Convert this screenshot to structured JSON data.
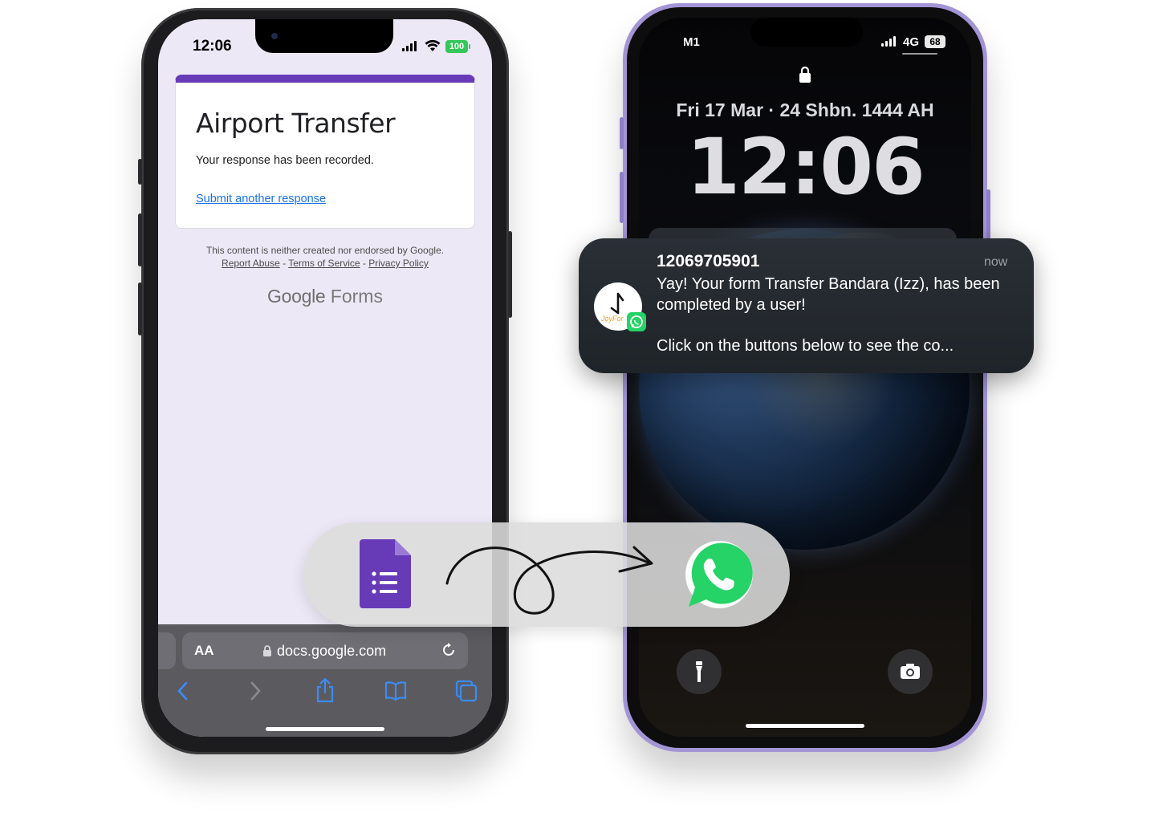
{
  "left_phone": {
    "status": {
      "time": "12:06",
      "battery": "100"
    },
    "form": {
      "title": "Airport Transfer",
      "message": "Your response has been recorded.",
      "link": "Submit another response"
    },
    "footer": {
      "disclaimer": "This content is neither created nor endorsed by Google.",
      "links": [
        "Report Abuse",
        "Terms of Service",
        "Privacy Policy"
      ],
      "separator": " - ",
      "logo_google": "Google",
      "logo_forms": "Forms"
    },
    "browser": {
      "text_size_label": "AA",
      "url": "docs.google.com"
    }
  },
  "right_phone": {
    "status": {
      "carrier": "M1",
      "network": "4G",
      "battery": "68"
    },
    "lock_date": "Fri 17 Mar · 24 Shbn. 1444 AH",
    "lock_time": "12:06",
    "notification": {
      "sender": "12069705901",
      "time": "now",
      "body": "Yay! Your form Transfer Bandara (Izz), has been completed by a user!",
      "cta": "Click on the buttons below to see the co...",
      "app_label": "JoyFor"
    }
  },
  "colors": {
    "forms_purple": "#673ab7",
    "link_blue": "#1a73e8",
    "whatsapp_green": "#25d366",
    "phone_frame_purple": "#a394d6",
    "safari_blue": "#3b8cf5"
  },
  "icons": [
    "google-forms-icon",
    "curly-arrow-icon",
    "whatsapp-icon",
    "flashlight-icon",
    "camera-icon",
    "lock-icon"
  ]
}
